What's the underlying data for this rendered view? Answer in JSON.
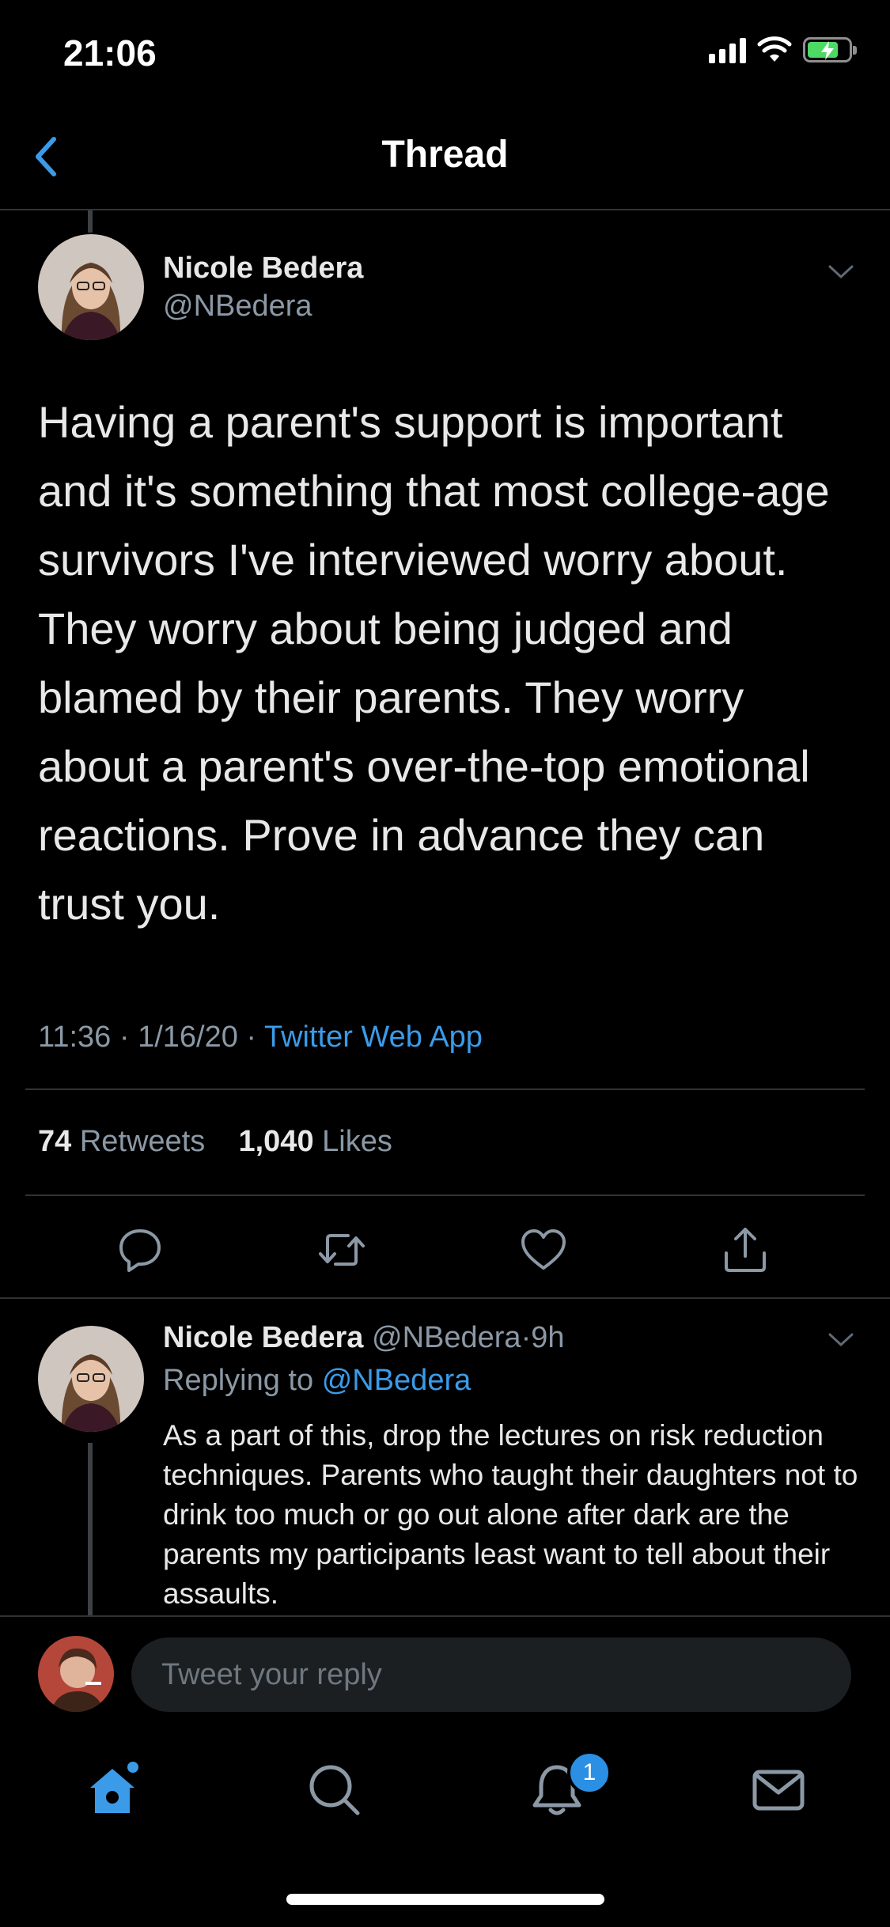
{
  "status_bar": {
    "time": "21:06",
    "battery_charging": true
  },
  "nav": {
    "title": "Thread",
    "back_icon": "chevron-left-icon"
  },
  "tweet": {
    "author_name": "Nicole Bedera",
    "author_handle": "@NBedera",
    "text": "Having a parent's support is important and it's something that most college-age survivors I've interviewed worry about. They worry about being judged and blamed by their parents. They worry about a parent's over-the-top emotional reactions. Prove in advance they can trust you.",
    "time": "11:36",
    "date": "1/16/20",
    "separator": "·",
    "source": "Twitter Web App",
    "retweets_count": "74",
    "retweets_label": "Retweets",
    "likes_count": "1,040",
    "likes_label": "Likes",
    "actions": [
      "reply-icon",
      "retweet-icon",
      "like-icon",
      "share-icon"
    ]
  },
  "reply": {
    "author_name": "Nicole Bedera",
    "author_handle": "@NBedera",
    "age": "9h",
    "separator": "·",
    "replying_prefix": "Replying to",
    "replying_to": "@NBedera",
    "text": "As a part of this, drop the lectures on risk reduction techniques. Parents who taught their daughters not to drink too much or go out alone after dark are the parents my participants least want to tell about their assaults."
  },
  "composer": {
    "placeholder": "Tweet your reply"
  },
  "tab_bar": {
    "tabs": [
      "home-icon",
      "search-icon",
      "notifications-icon",
      "messages-icon"
    ],
    "notification_badge": "1"
  },
  "colors": {
    "background": "#000000",
    "accent": "#3b9be8",
    "muted": "#8b98a5",
    "divider": "#2f3336"
  }
}
